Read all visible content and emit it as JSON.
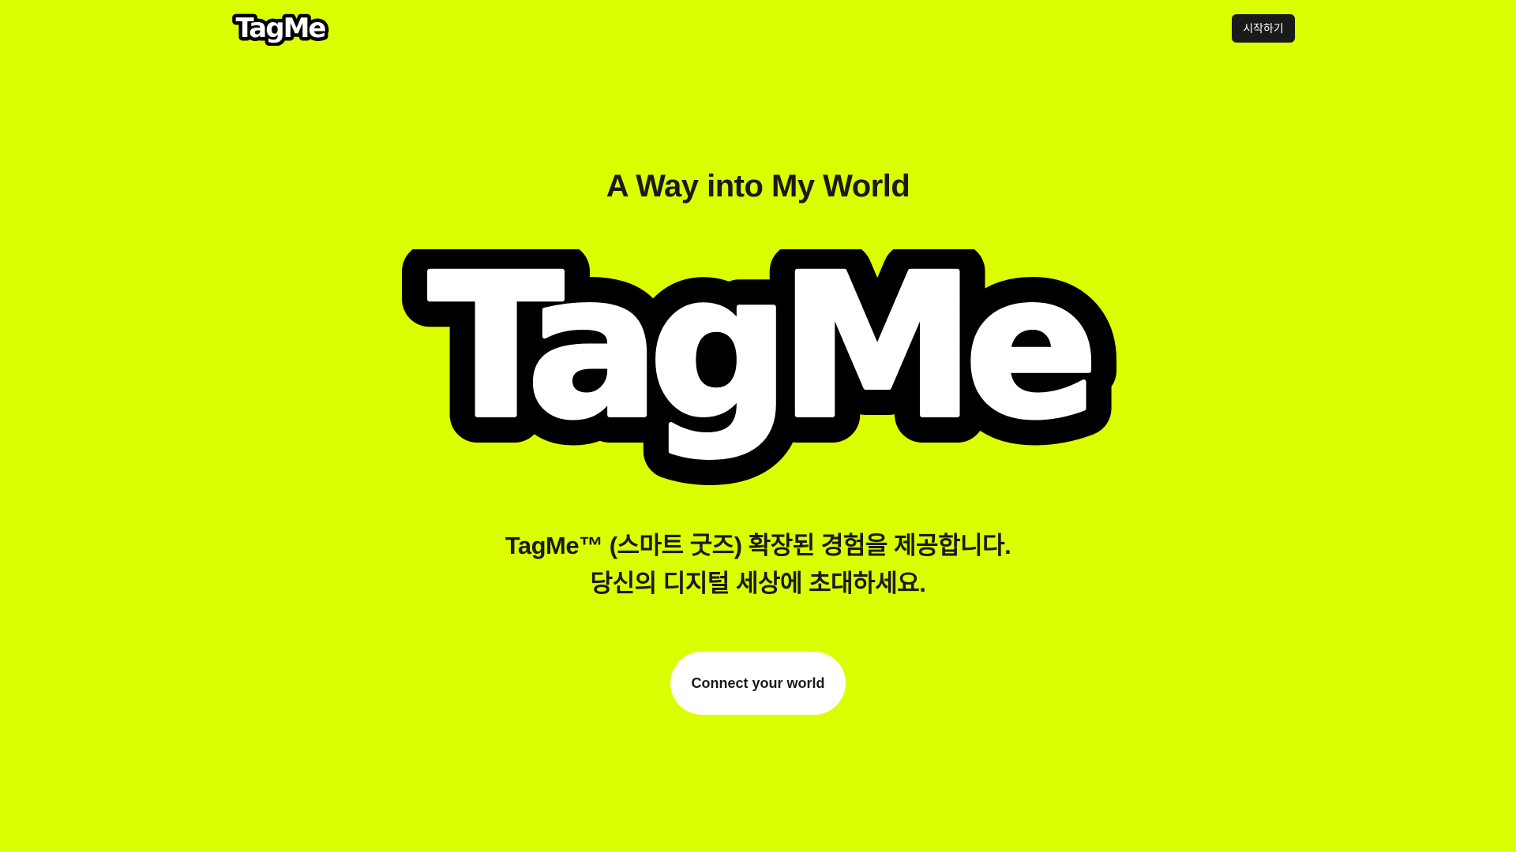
{
  "header": {
    "logo_text": "TagMe",
    "start_button_label": "시작하기"
  },
  "hero": {
    "tagline": "A Way into My World",
    "logo_text": "TagMe",
    "description_line1": "TagMe™ (스마트 굿즈) 확장된 경험을 제공합니다.",
    "description_line2": "당신의 디지털 세상에 초대하세요.",
    "cta_label": "Connect your world"
  },
  "colors": {
    "background": "#dbff00",
    "text": "#1a1a1a",
    "button_dark": "#1a1a1a",
    "button_light": "#ffffff",
    "logo_fill": "#ffffff",
    "logo_outline": "#000000"
  }
}
